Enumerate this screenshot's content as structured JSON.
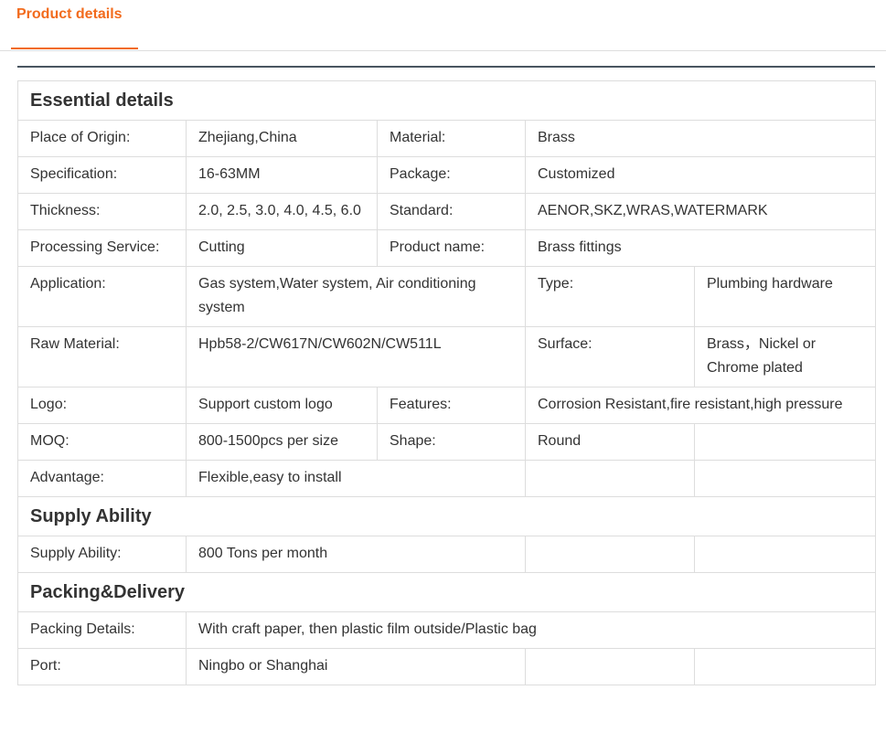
{
  "tabs": [
    {
      "label": "Product details",
      "active": true
    }
  ],
  "colors": {
    "accent": "#f26b1d",
    "border": "#dddddd",
    "rule": "#495560"
  },
  "sections": {
    "essential": "Essential details",
    "supply": "Supply Ability",
    "packing": "Packing&Delivery"
  },
  "details": {
    "place_of_origin": {
      "label": "Place of Origin:",
      "value": "Zhejiang,China"
    },
    "material": {
      "label": "Material:",
      "value": "Brass"
    },
    "specification": {
      "label": "Specification:",
      "value": "16-63MM"
    },
    "package": {
      "label": "Package:",
      "value": "Customized"
    },
    "thickness": {
      "label": "Thickness:",
      "value": "2.0, 2.5, 3.0, 4.0, 4.5, 6.0"
    },
    "standard": {
      "label": "Standard:",
      "value": "AENOR,SKZ,WRAS,WATERMARK"
    },
    "processing_service": {
      "label": "Processing Service:",
      "value": "Cutting"
    },
    "product_name": {
      "label": "Product name:",
      "value": "Brass fittings"
    },
    "application": {
      "label": "Application:",
      "value": "Gas system,Water system, Air conditioning system"
    },
    "type": {
      "label": "Type:",
      "value": "Plumbing hardware"
    },
    "raw_material": {
      "label": "Raw Material:",
      "value": "Hpb58-2/CW617N/CW602N/CW511L"
    },
    "surface": {
      "label": "Surface:",
      "value": "Brass，Nickel or Chrome plated"
    },
    "logo": {
      "label": "Logo:",
      "value": "Support custom logo"
    },
    "features": {
      "label": "Features:",
      "value": "Corrosion Resistant,fire resistant,high pressure"
    },
    "moq": {
      "label": "MOQ:",
      "value": "800-1500pcs per size"
    },
    "shape": {
      "label": "Shape:",
      "value": "Round"
    },
    "advantage": {
      "label": "Advantage:",
      "value": "Flexible,easy to install"
    }
  },
  "supply": {
    "supply_ability": {
      "label": "Supply Ability:",
      "value": "800 Tons per month"
    }
  },
  "packing": {
    "packing_details": {
      "label": "Packing Details:",
      "value": "With craft paper, then plastic film outside/Plastic bag"
    },
    "port": {
      "label": "Port:",
      "value": "Ningbo or Shanghai"
    }
  }
}
